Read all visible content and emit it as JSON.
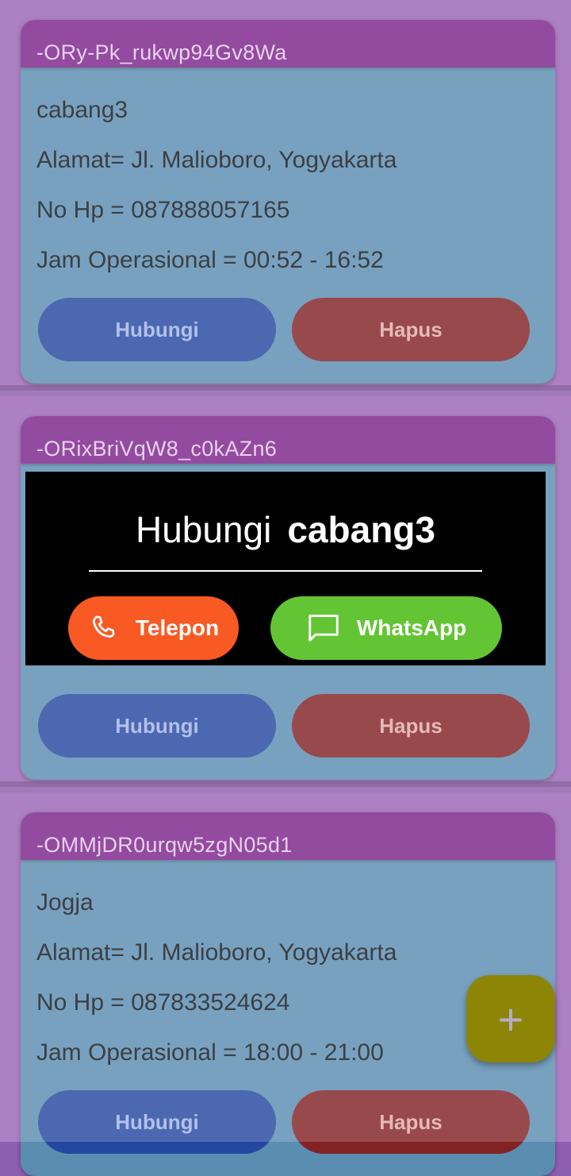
{
  "cards": [
    {
      "id": "-ORy-Pk_rukwp94Gv8Wa",
      "name": "cabang3",
      "alamat": "Alamat= Jl. Malioboro, Yogyakarta",
      "nohp": "No Hp =  087888057165",
      "jam": "Jam Operasional = 00:52 - 16:52",
      "hubungi_label": "Hubungi",
      "hapus_label": "Hapus"
    },
    {
      "id": "-ORixBriVqW8_c0kAZn6",
      "hubungi_label": "Hubungi",
      "hapus_label": "Hapus"
    },
    {
      "id": "-OMMjDR0urqw5zgN05d1",
      "name": "Jogja",
      "alamat": "Alamat= Jl. Malioboro, Yogyakarta",
      "nohp": "No Hp =  087833524624",
      "jam": "Jam Operasional = 18:00 - 21:00",
      "hubungi_label": "Hubungi",
      "hapus_label": "Hapus"
    }
  ],
  "dialog": {
    "prefix": "Hubungi",
    "name": "cabang3",
    "telepon_label": "Telepon",
    "whatsapp_label": "WhatsApp",
    "telepon_color": "#f95a24",
    "whatsapp_color": "#63c534"
  },
  "fab": {
    "icon": "plus-icon",
    "label": "+"
  },
  "colors": {
    "card_body": "#5b8db1",
    "card_header": "#7a2489",
    "hubungi_button": "#2447a0",
    "hapus_button": "#822224",
    "fab": "#8d8505"
  }
}
